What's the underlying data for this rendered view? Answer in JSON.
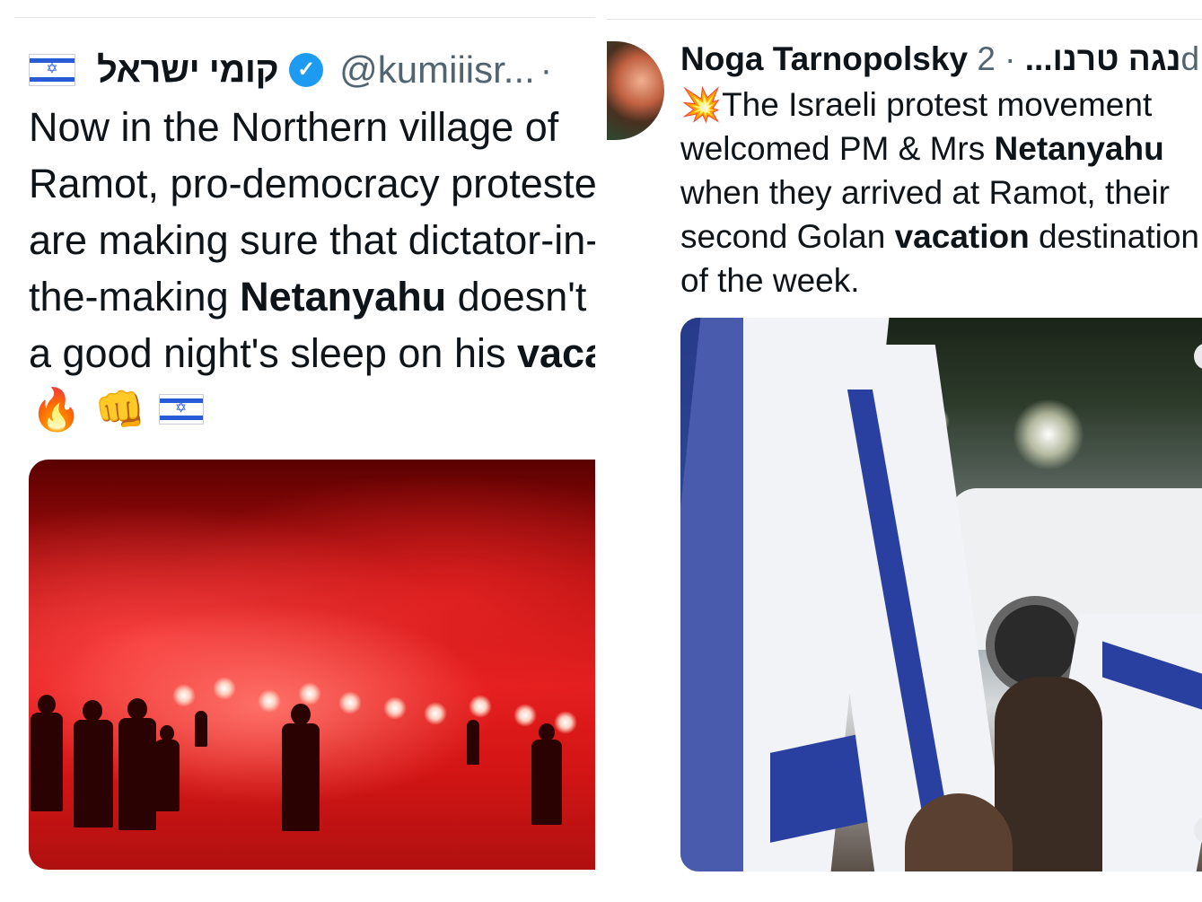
{
  "left_tweet": {
    "display_name": "קומי ישראל",
    "handle": "@kumiiisr...",
    "separator": "·",
    "text_lines": [
      "Now in the Northern village of",
      "Ramot, pro-democracy protesters",
      "are making sure that dictator-in-",
      "the-making ",
      "a good night's sleep on his "
    ],
    "bold_word_netanyahu": "Netanyahu",
    "line4_tail": " doesn't get",
    "bold_word_vacation": "vacation",
    "icons": [
      "israel-flag-icon",
      "verified-badge-icon",
      "fire-icon",
      "fist-icon",
      "israel-flag-icon"
    ],
    "emoji_fire": "🔥",
    "emoji_fist": "👊",
    "image_alt": "Protesters holding red flares in a field at night"
  },
  "right_tweet": {
    "display_name": "Noga Tarnopolsky נגה טרנו...",
    "time": "· 2d",
    "emoji_burst": "💥",
    "text_lines": [
      "The Israeli protest movement",
      "welcomed PM & Mrs ",
      "when they arrived at Ramot, their",
      "second Golan ",
      "of the week."
    ],
    "bold_word_netanyahu": "Netanyahu",
    "bold_word_vacation": "vacation",
    "line4_tail": " destination",
    "image_alt": "Video still of Israeli flags waving near a white vehicle at night"
  },
  "colors": {
    "verified": "#1d9bf0",
    "secondary_text": "#536471",
    "flag_blue": "#2a5bd7"
  }
}
